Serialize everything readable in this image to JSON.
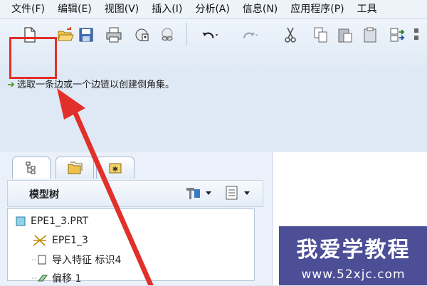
{
  "menu": [
    "文件(F)",
    "编辑(E)",
    "视图(V)",
    "插入(I)",
    "分析(A)",
    "信息(N)",
    "应用程序(P)",
    "工具"
  ],
  "toolbar": {
    "icons": [
      "new-file-icon",
      "open-folder-icon",
      "save-icon",
      "print-icon",
      "lock-icon",
      "link-icon",
      "undo-icon",
      "redo-icon",
      "cut-icon",
      "copy-icon",
      "paste-icon",
      "paste-special-icon",
      "regenerate-icon"
    ]
  },
  "status_message": "选取一条边或一个边链以创建倒角集。",
  "panel": {
    "tabs": [
      "model-tree-tab",
      "folder-browser-tab",
      "favorites-tab"
    ],
    "header_title": "模型树",
    "tree": [
      {
        "label": "EPE1_3.PRT",
        "icon": "part-icon"
      },
      {
        "label": "EPE1_3",
        "icon": "csys-icon"
      },
      {
        "label": "导入特征 标识4",
        "icon": "import-feature-icon"
      },
      {
        "label": "偏移 1",
        "icon": "offset-feature-icon"
      }
    ]
  },
  "watermark": {
    "title": "我爱学教程",
    "url": "www.52xjc.com"
  },
  "colors": {
    "highlight": "#e1302a",
    "watermark_bg": "#3e418e",
    "status_arrow": "#4a9a2c"
  }
}
